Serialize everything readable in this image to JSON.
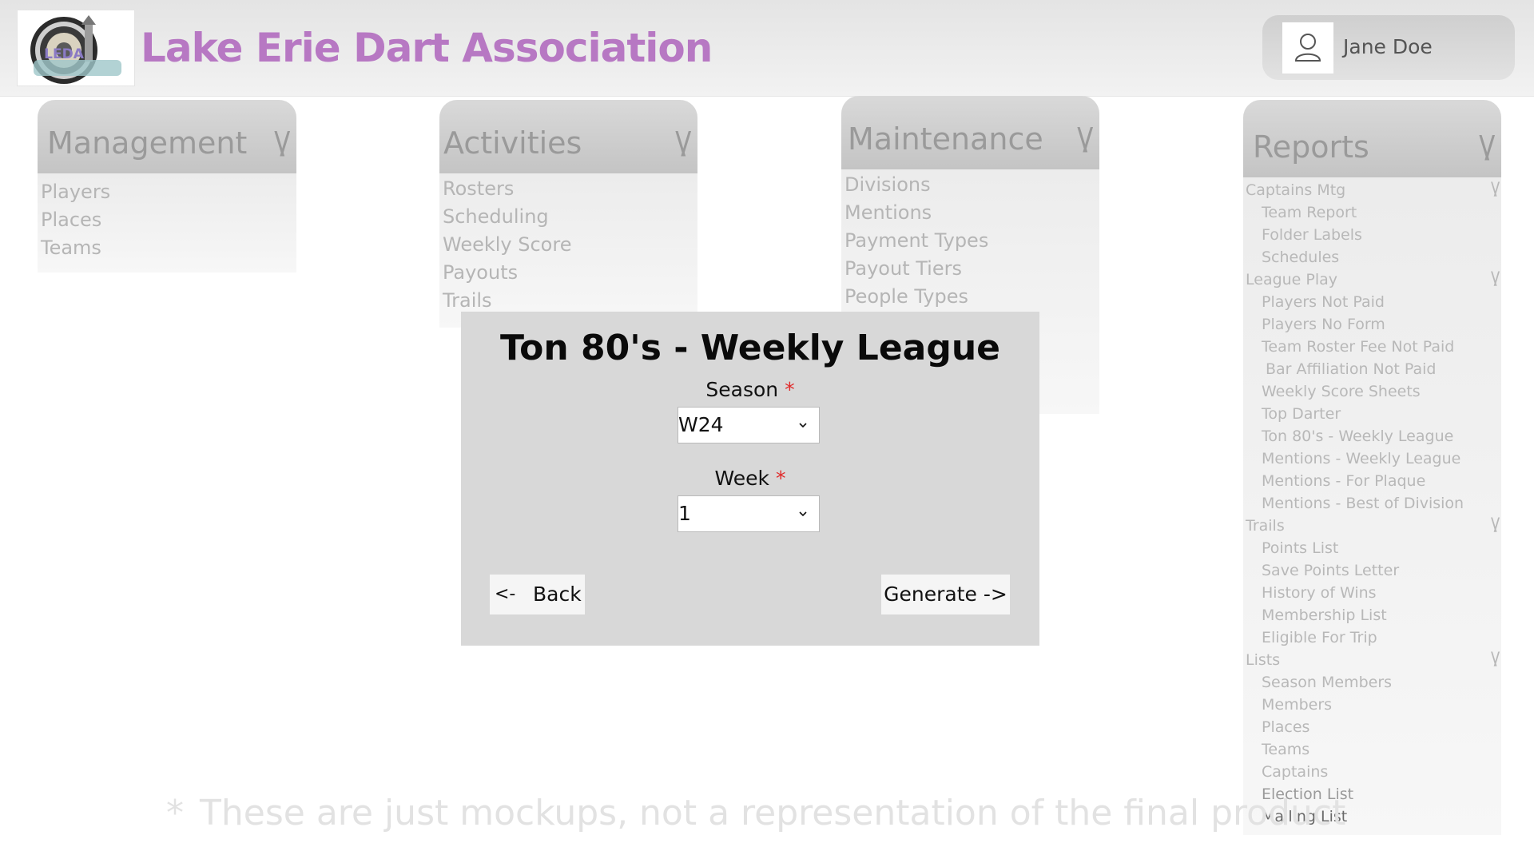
{
  "header": {
    "logo_label": "LEDA",
    "title": "Lake Erie Dart Association",
    "user_name": "Jane Doe",
    "user_icon": "user-icon"
  },
  "menus": {
    "management": {
      "title": "Management",
      "chevron": "\\/",
      "items": [
        "Players",
        "Places",
        "Teams"
      ]
    },
    "activities": {
      "title": "Activities",
      "chevron": "\\/",
      "items": [
        "Rosters",
        "Scheduling",
        "Weekly Score",
        "Payouts",
        "Trails"
      ]
    },
    "maintenance": {
      "title": "Maintenance",
      "chevron": "\\/",
      "items": [
        "Divisions",
        "Mentions",
        "Payment Types",
        "Payout Tiers",
        "People Types"
      ]
    },
    "reports": {
      "title": "Reports",
      "chevron": "\\/",
      "groups": [
        {
          "label": "Captains Mtg",
          "chevron": "\\/",
          "items": [
            "Team Report",
            "Folder Labels",
            "Schedules"
          ]
        },
        {
          "label": "League Play",
          "chevron": "\\/",
          "items": [
            "Players Not Paid",
            "Players No Form",
            "Team Roster Fee Not Paid",
            "Bar Affiliation Not Paid",
            "Weekly Score Sheets",
            "Top Darter",
            "Ton 80's - Weekly League",
            "Mentions - Weekly League",
            "Mentions - For Plaque",
            "Mentions - Best of Division"
          ]
        },
        {
          "label": "Trails",
          "chevron": "\\/",
          "items": [
            "Points List",
            "Save Points Letter",
            "History of Wins",
            "Membership List",
            "Eligible For Trip"
          ]
        },
        {
          "label": "Lists",
          "chevron": "\\/",
          "items": [
            "Season Members",
            "Members",
            "Places",
            "Teams",
            "Captains",
            "Election List",
            "Mailing List"
          ]
        }
      ]
    }
  },
  "dialog": {
    "title": "Ton 80's - Weekly League",
    "season": {
      "label": "Season",
      "required_mark": "*",
      "value": "W24"
    },
    "week": {
      "label": "Week",
      "required_mark": "*",
      "value": "1"
    },
    "back_arrow": "<-",
    "back_label": "Back",
    "generate_label": "Generate ->"
  },
  "footnote": {
    "star": "*",
    "text": "These are just mockups, not a representation of the final product"
  },
  "colors": {
    "title_purple": "#b778c3",
    "required_red": "#e02a2a",
    "dialog_bg": "#d8d8d8"
  }
}
